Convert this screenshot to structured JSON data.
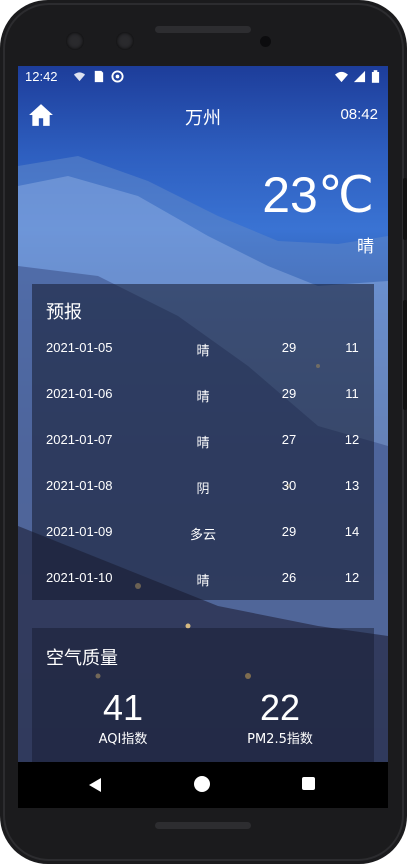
{
  "status_bar": {
    "time": "12:42"
  },
  "header": {
    "city": "万州",
    "clock": "08:42"
  },
  "current": {
    "temperature": "23℃",
    "condition": "晴"
  },
  "forecast": {
    "title": "预报",
    "rows": [
      {
        "date": "2021-01-05",
        "weather": "晴",
        "high": "29",
        "low": "11"
      },
      {
        "date": "2021-01-06",
        "weather": "晴",
        "high": "29",
        "low": "11"
      },
      {
        "date": "2021-01-07",
        "weather": "晴",
        "high": "27",
        "low": "12"
      },
      {
        "date": "2021-01-08",
        "weather": "阴",
        "high": "30",
        "low": "13"
      },
      {
        "date": "2021-01-09",
        "weather": "多云",
        "high": "29",
        "low": "14"
      },
      {
        "date": "2021-01-10",
        "weather": "晴",
        "high": "26",
        "low": "12"
      }
    ]
  },
  "air_quality": {
    "title": "空气质量",
    "aqi_value": "41",
    "aqi_label": "AQI指数",
    "pm25_value": "22",
    "pm25_label": "PM2.5指数"
  },
  "icons": {
    "home": "home-icon",
    "back": "back-icon",
    "nav_home": "circle-home-icon",
    "recents": "square-recents-icon"
  }
}
